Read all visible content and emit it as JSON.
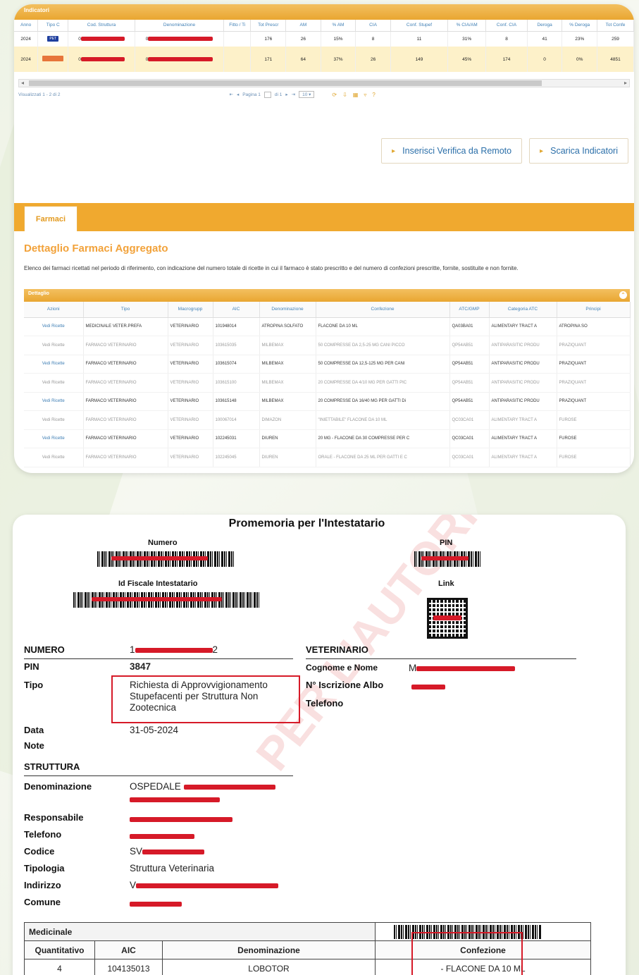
{
  "indicatori": {
    "panel_title": "Indicatori",
    "columns": [
      "Anno",
      "Tipo C",
      "Cod. Struttura",
      "Denominazione",
      "Fitto / Ti",
      "Tot Prescr",
      "AM",
      "% AM",
      "CIA",
      "Conf. Stupef",
      "% CIA/AM",
      "Conf. CIA",
      "Deroga",
      "% Deroga",
      "Tot Confe"
    ],
    "rows": [
      {
        "anno": "2024",
        "tipo": "PET",
        "tipo_color": "#1f3f9e",
        "cod": "0",
        "den": "0",
        "fitto": "",
        "values": [
          "176",
          "26",
          "15%",
          "8",
          "11",
          "31%",
          "8",
          "41",
          "23%",
          "259"
        ]
      },
      {
        "anno": "2024",
        "tipo": "",
        "tipo_color": "#e7753a",
        "cod": "0",
        "den": "0",
        "fitto": "",
        "values": [
          "171",
          "64",
          "37%",
          "26",
          "149",
          "45%",
          "174",
          "0",
          "0%",
          "4851"
        ]
      }
    ],
    "pager_left": "Visualizzati 1 - 2 di 2",
    "pager_page": "Pagina 1",
    "pager_of": "di 1",
    "pager_size": "10",
    "btn_verifica": "Inserisci Verifica da Remoto",
    "btn_scarica": "Scarica Indicatori"
  },
  "farmaci": {
    "tab_label": "Farmaci",
    "title": "Dettaglio Farmaci Aggregato",
    "description": "Elenco dei farmaci ricettati nel periodo di riferimento, con indicazione del numero totale di ricette in cui il farmaco è stato prescritto e del numero di confezioni prescritte, fornite, sostituite e non fornite.",
    "panel_title": "Dettaglio",
    "columns": [
      "Azioni",
      "Tipo",
      "Macrogrupp",
      "AIC",
      "Denominazione",
      "Confezione",
      "ATC/GMP",
      "Categoria ATC",
      "Principi"
    ],
    "rows": [
      [
        "Vedi Ricette",
        "MEDICINALE VETER.PREFA",
        "VETERINARIO",
        "101948014",
        "ATROPINA SOLFATO",
        "FLACONE DA 10 ML",
        "QA03BA01",
        "ALIMENTARY TRACT A",
        "ATROPINA SO"
      ],
      [
        "Vedi Ricette",
        "FARMACO VETERINARIO",
        "VETERINARIO",
        "103615035",
        "MILBEMAX",
        "50 COMPRESSE DA 2,5-25 MG CANI PICCO",
        "QP54AB51",
        "ANTIPARASITIC PRODU",
        "PRAZIQUANT"
      ],
      [
        "Vedi Ricette",
        "FARMACO VETERINARIO",
        "VETERINARIO",
        "103615074",
        "MILBEMAX",
        "50 COMPRESSE DA 12,5-125 MG PER CANI",
        "QP54AB51",
        "ANTIPARASITIC PRODU",
        "PRAZIQUANT"
      ],
      [
        "Vedi Ricette",
        "FARMACO VETERINARIO",
        "VETERINARIO",
        "103615100",
        "MILBEMAX",
        "20 COMPRESSE DA 4/10 MG PER GATTI PIC",
        "QP54AB51",
        "ANTIPARASITIC PRODU",
        "PRAZIQUANT"
      ],
      [
        "Vedi Ricette",
        "FARMACO VETERINARIO",
        "VETERINARIO",
        "103615148",
        "MILBEMAX",
        "20 COMPRESSE DA 16/40 MG PER GATTI Di",
        "QP54AB51",
        "ANTIPARASITIC PRODU",
        "PRAZIQUANT"
      ],
      [
        "Vedi Ricette",
        "FARMACO VETERINARIO",
        "VETERINARIO",
        "100067014",
        "DIMAZON",
        "\"INIETTABILE\" FLACONE DA 10 ML",
        "QC03CA01",
        "ALIMENTARY TRACT A",
        "FUROSE"
      ],
      [
        "Vedi Ricette",
        "FARMACO VETERINARIO",
        "VETERINARIO",
        "102245031",
        "DIUREN",
        "20 MG - FLACONE DA 30 COMPRESSE PER C",
        "QC03CA01",
        "ALIMENTARY TRACT A",
        "FUROSE"
      ],
      [
        "Vedi Ricette",
        "FARMACO VETERINARIO",
        "VETERINARIO",
        "102245045",
        "DIUREN",
        "ORALE - FLACONE DA 25 ML PER GATTI E C",
        "QC03CA01",
        "ALIMENTARY TRACT A",
        "FUROSE"
      ]
    ]
  },
  "promemoria": {
    "title": "Promemoria per l'Intestatario",
    "numero_label": "Numero",
    "pin_label": "PIN",
    "idfiscale_label": "Id Fiscale Intestatario",
    "link_label": "Link",
    "fields_left": [
      {
        "label": "NUMERO",
        "value": "1",
        "value_tail": "2"
      },
      {
        "label": "PIN",
        "value": "3847"
      },
      {
        "label": "Tipo",
        "value": "Richiesta di Approvvigionamento Stupefacenti per Struttura Non Zootecnica"
      },
      {
        "label": "Data",
        "value": "31-05-2024"
      },
      {
        "label": "Note",
        "value": ""
      }
    ],
    "veterinario": {
      "section": "VETERINARIO",
      "cognome_label": "Cognome e Nome",
      "cognome_value": "M",
      "iscrizione_label": "N° Iscrizione Albo",
      "telefono_label": "Telefono"
    },
    "struttura": {
      "section": "STRUTTURA",
      "denominazione_label": "Denominazione",
      "denominazione_value": "OSPEDALE",
      "responsabile_label": "Responsabile",
      "telefono_label": "Telefono",
      "codice_label": "Codice",
      "codice_value": "SV",
      "tipologia_label": "Tipologia",
      "tipologia_value": "Struttura Veterinaria",
      "indirizzo_label": "Indirizzo",
      "indirizzo_value": "V",
      "comune_label": "Comune"
    },
    "medicinale": {
      "title": "Medicinale",
      "columns": [
        "Quantitativo",
        "AIC",
        "Denominazione",
        "Confezione"
      ],
      "row": [
        "4",
        "104135013",
        "LOBOTOR",
        "- FLACONE DA 10 ML"
      ]
    },
    "watermark": "PER L'AUTORITÀ COMPETENTE"
  },
  "colors": {
    "accent": "#f0a92f",
    "link": "#3f7fb5",
    "redaction": "#d61a28"
  }
}
